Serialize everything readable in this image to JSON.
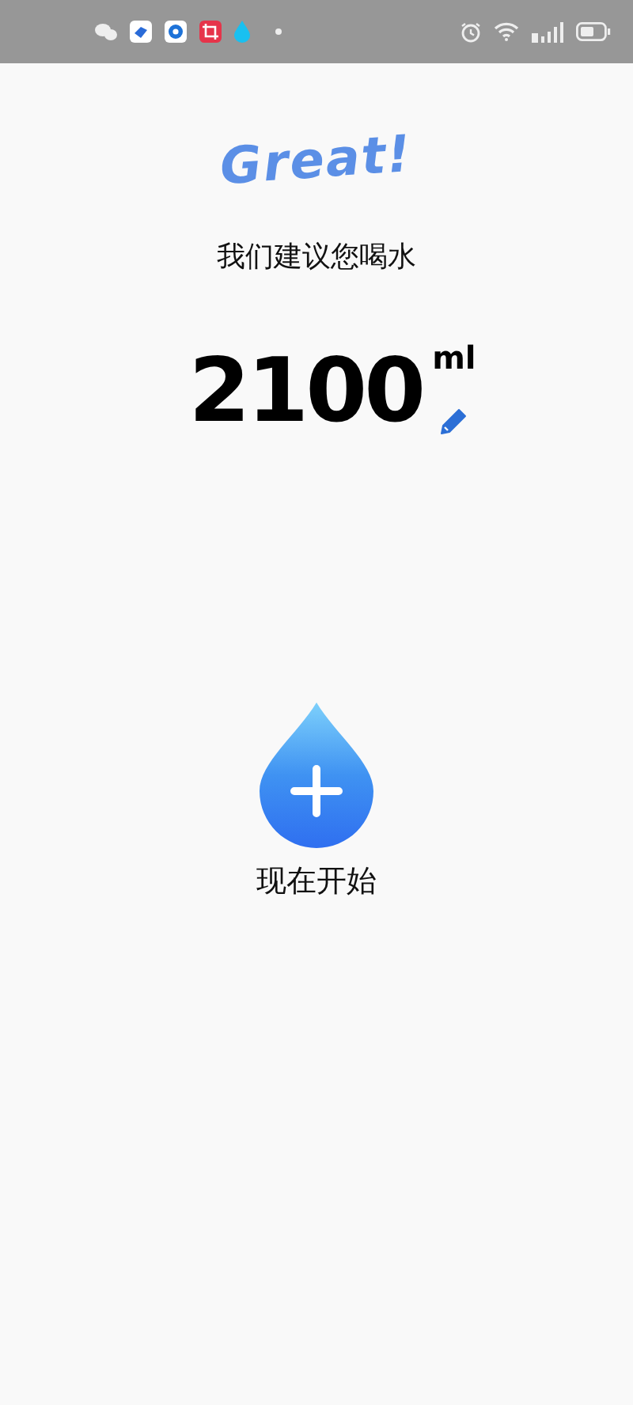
{
  "headline": "Great!",
  "subtitle": "我们建议您喝水",
  "goal": {
    "amount": "2100",
    "unit": "ml"
  },
  "start": {
    "label": "现在开始"
  }
}
